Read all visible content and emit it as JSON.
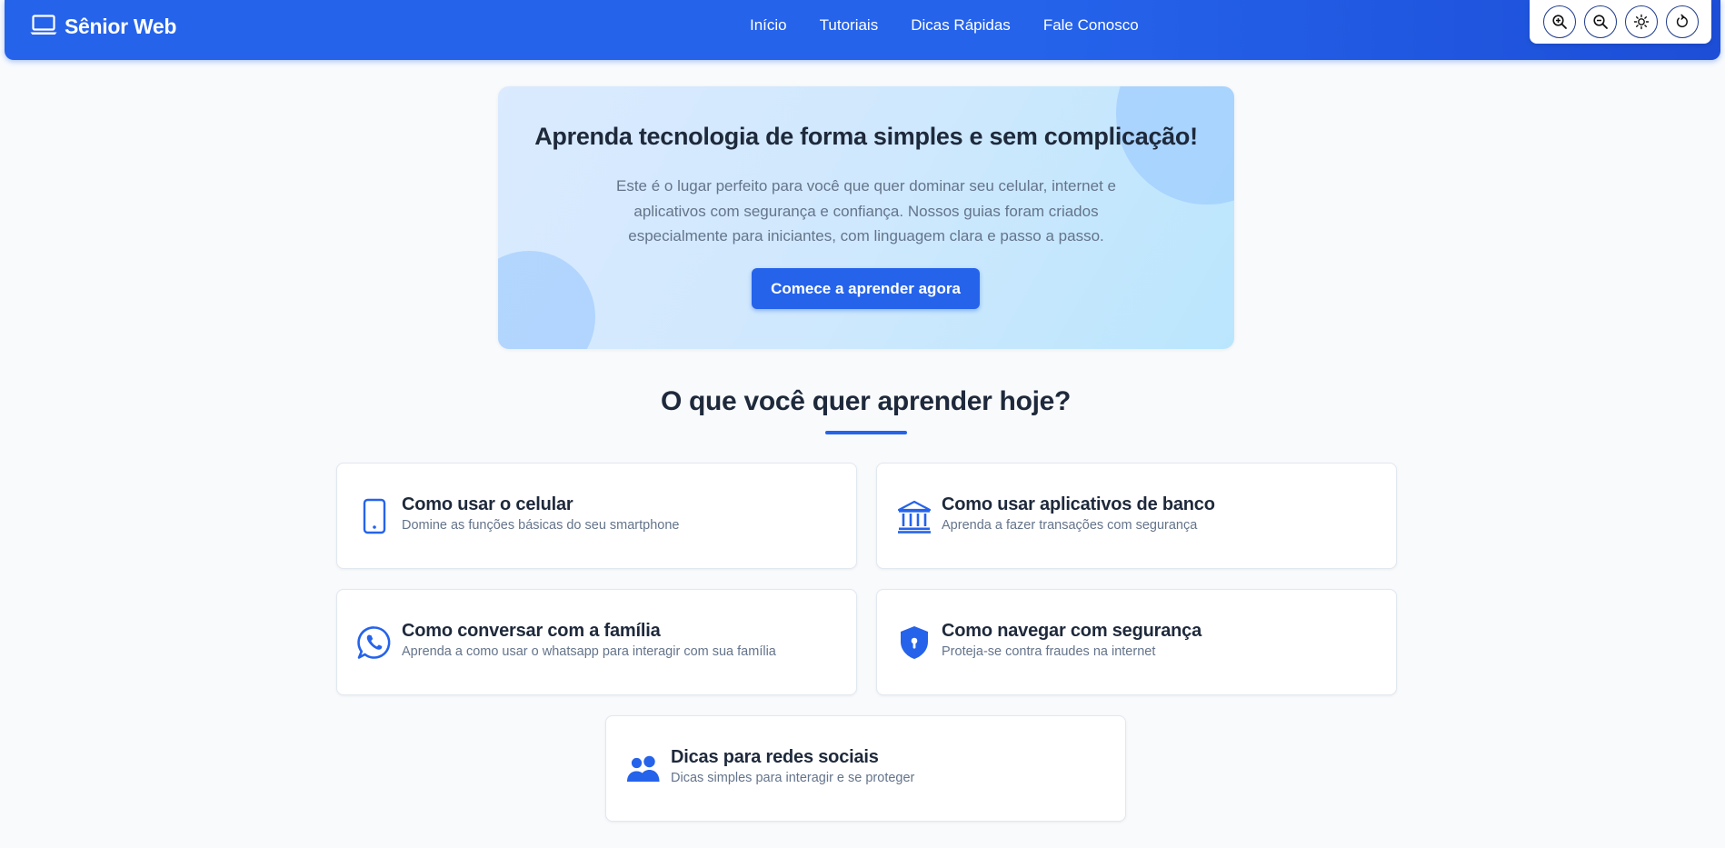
{
  "brand": {
    "name": "Sênior Web",
    "icon": "laptop-icon"
  },
  "nav": {
    "links": [
      "Início",
      "Tutoriais",
      "Dicas Rápidas",
      "Fale Conosco"
    ]
  },
  "accessibility": {
    "buttons": [
      "zoom-in-icon",
      "zoom-out-icon",
      "brightness-icon",
      "reset-icon"
    ]
  },
  "hero": {
    "title": "Aprenda tecnologia de forma simples e sem complicação!",
    "text": "Este é o lugar perfeito para você que quer dominar seu celular, internet e aplicativos com segurança e confiança. Nossos guias foram criados especialmente para iniciantes, com linguagem clara e passo a passo.",
    "cta": "Comece a aprender agora"
  },
  "section": {
    "title": "O que você quer aprender hoje?"
  },
  "cards": [
    {
      "title": "Como usar o celular",
      "desc": "Domine as funções básicas do seu smartphone",
      "icon": "smartphone-icon"
    },
    {
      "title": "Como usar aplicativos de banco",
      "desc": "Aprenda a fazer transações com segurança",
      "icon": "bank-icon"
    },
    {
      "title": "Como conversar com a família",
      "desc": "Aprenda a como usar o whatsapp para interagir com sua família",
      "icon": "whatsapp-icon"
    },
    {
      "title": "Como navegar com segurança",
      "desc": "Proteja-se contra fraudes na internet",
      "icon": "shield-lock-icon"
    },
    {
      "title": "Dicas para redes sociais",
      "desc": "Dicas simples para interagir e se proteger",
      "icon": "users-icon"
    }
  ],
  "colors": {
    "primary": "#2563eb",
    "text": "#1e293b",
    "muted": "#64748b"
  }
}
